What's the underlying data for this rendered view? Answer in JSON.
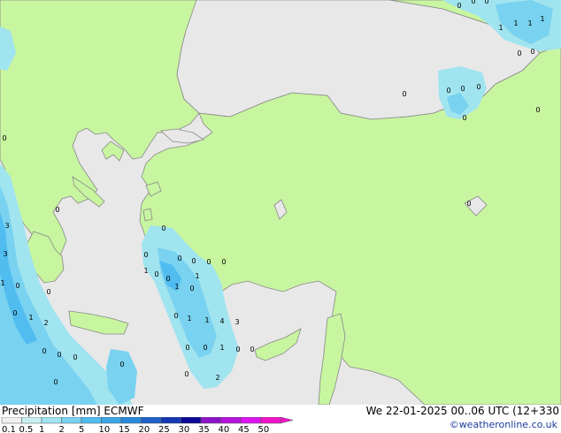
{
  "title": {
    "variable": "Precipitation [mm]",
    "model": "ECMWF",
    "datetime": "We 22-01-2025 00..06 UTC (12+330"
  },
  "credit": "©weatheronline.co.uk",
  "legend": {
    "labels": [
      "0.1",
      "0.5",
      "1",
      "2",
      "5",
      "10",
      "15",
      "20",
      "25",
      "30",
      "35",
      "40",
      "45",
      "50"
    ],
    "colors": [
      "#f0f0f0",
      "#c8f0f0",
      "#a0e4f0",
      "#78d2f0",
      "#50bcf0",
      "#3ca6e6",
      "#2a88dc",
      "#2060c8",
      "#1438b4",
      "#0a0a96",
      "#8c14c8",
      "#b414dc",
      "#dc14f0",
      "#f014c8"
    ]
  },
  "colors": {
    "land": "#c8f5a0",
    "sea": "#e8e8e8",
    "precip_light": "#a0e4f0",
    "precip_medium": "#78d2f0",
    "precip_heavy": "#50bcf0"
  },
  "map_labels": [
    {
      "text": "1"
    },
    {
      "text": "1"
    },
    {
      "text": "1"
    },
    {
      "text": "1"
    },
    {
      "text": "0"
    },
    {
      "text": "0"
    },
    {
      "text": "0"
    },
    {
      "text": "0"
    },
    {
      "text": "0"
    },
    {
      "text": "0"
    },
    {
      "text": "0"
    },
    {
      "text": "0"
    },
    {
      "text": "0"
    },
    {
      "text": "0"
    },
    {
      "text": "0"
    },
    {
      "text": "0"
    },
    {
      "text": "0"
    },
    {
      "text": "0"
    },
    {
      "text": "0"
    },
    {
      "text": "3"
    },
    {
      "text": "3"
    },
    {
      "text": "1"
    },
    {
      "text": "0"
    },
    {
      "text": "0"
    },
    {
      "text": "0"
    },
    {
      "text": "1"
    },
    {
      "text": "2"
    },
    {
      "text": "0"
    },
    {
      "text": "0"
    },
    {
      "text": "0"
    },
    {
      "text": "0"
    },
    {
      "text": "0"
    },
    {
      "text": "1"
    },
    {
      "text": "0"
    },
    {
      "text": "0"
    },
    {
      "text": "0"
    },
    {
      "text": "0"
    },
    {
      "text": "1"
    },
    {
      "text": "0"
    },
    {
      "text": "0"
    },
    {
      "text": "1"
    },
    {
      "text": "1"
    },
    {
      "text": "4"
    },
    {
      "text": "3"
    },
    {
      "text": "0"
    },
    {
      "text": "0"
    },
    {
      "text": "1"
    },
    {
      "text": "0"
    },
    {
      "text": "0"
    },
    {
      "text": "0"
    },
    {
      "text": "0"
    },
    {
      "text": "2"
    },
    {
      "text": "0"
    },
    {
      "text": "0"
    },
    {
      "text": "1"
    }
  ]
}
